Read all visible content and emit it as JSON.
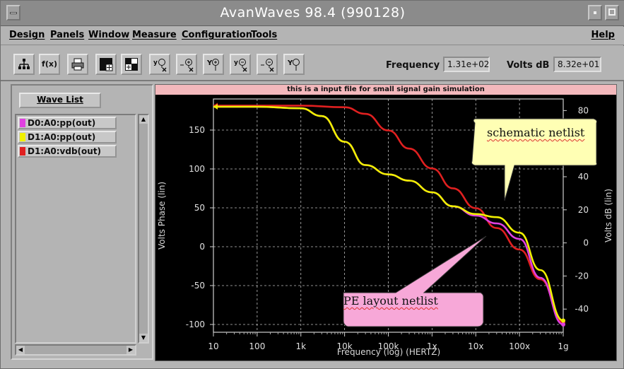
{
  "window": {
    "title": "AvanWaves 98.4   (990128)"
  },
  "menu": {
    "items": [
      "Design",
      "Panels",
      "Window",
      "Measure",
      "Configuration",
      "Tools"
    ],
    "help": "Help"
  },
  "toolbar": {
    "tools": [
      "tree-icon",
      "function-icon",
      "print-icon",
      "panel-icon",
      "panel-add-icon",
      "y-zoom-x-icon",
      "zoom-in-icon",
      "y-zoom-in-icon",
      "y-zoom-out-icon",
      "zoom-out-icon",
      "y-zoom-icon"
    ],
    "fx_label": "f(x)",
    "frequency_label": "Frequency",
    "frequency_value": "1.31e+02",
    "voltsdb_label": "Volts dB",
    "voltsdb_value": "8.32e+01"
  },
  "wavelist": {
    "button_label": "Wave List",
    "waves": [
      {
        "label": "D0:A0:pp(out)",
        "color": "#e040e0"
      },
      {
        "label": "D1:A0:pp(out)",
        "color": "#f0f000"
      },
      {
        "label": "D1:A0:vdb(out)",
        "color": "#e02020"
      }
    ]
  },
  "plot": {
    "header": "this is a input file for small signal gain simulation",
    "callout_top": "schematic netlist",
    "callout_bottom": "PE layout netlist"
  },
  "chart_data": {
    "type": "line",
    "title": "this is a input file for small signal gain simulation",
    "xlabel": "Frequency (log) (HERTZ)",
    "ylabel": "Volts Phase (lin)",
    "y2label": "Volts dB (lin)",
    "xscale": "log",
    "x_tick_labels": [
      "10",
      "100",
      "1k",
      "10k",
      "100k",
      "1x",
      "10x",
      "100x",
      "1g"
    ],
    "x_tick_values": [
      10,
      100,
      1000,
      10000,
      100000,
      1000000,
      10000000,
      100000000,
      1000000000
    ],
    "xlim": [
      10,
      1000000000
    ],
    "ylim": [
      -110,
      190
    ],
    "y_ticks": [
      -100,
      -50,
      0,
      50,
      100,
      150
    ],
    "y2lim": [
      -54,
      87
    ],
    "y2_ticks": [
      -40,
      -20,
      0,
      20,
      40,
      60,
      80
    ],
    "grid": true,
    "series": [
      {
        "name": "D0:A0:pp(out)",
        "axis": "left",
        "color": "#e040e0",
        "x": [
          10,
          100,
          1000,
          3000,
          10000,
          30000,
          100000,
          300000,
          1000000,
          3000000,
          10000000,
          30000000,
          100000000,
          300000000,
          1000000000
        ],
        "y": [
          180,
          180,
          178,
          168,
          135,
          105,
          93,
          85,
          70,
          52,
          40,
          30,
          10,
          -40,
          -100
        ]
      },
      {
        "name": "D1:A0:pp(out)",
        "axis": "left",
        "color": "#f0f000",
        "x": [
          10,
          100,
          1000,
          3000,
          10000,
          30000,
          100000,
          300000,
          1000000,
          3000000,
          10000000,
          30000000,
          100000000,
          300000000,
          1000000000
        ],
        "y": [
          180,
          180,
          178,
          168,
          135,
          105,
          93,
          85,
          70,
          52,
          42,
          38,
          18,
          -30,
          -95
        ]
      },
      {
        "name": "D1:A0:vdb(out)",
        "axis": "right",
        "color": "#e02020",
        "x": [
          10,
          100,
          1000,
          10000,
          30000,
          100000,
          300000,
          1000000,
          3000000,
          10000000,
          30000000,
          100000000,
          300000000,
          1000000000
        ],
        "y": [
          83,
          83,
          83,
          82,
          78,
          68,
          57,
          45,
          33,
          21,
          9,
          -4,
          -22,
          -48
        ]
      }
    ]
  }
}
